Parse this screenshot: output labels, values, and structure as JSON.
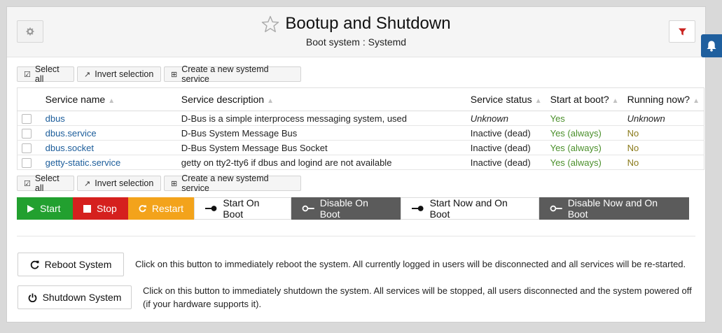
{
  "header": {
    "title": "Bootup and Shutdown",
    "subtitle": "Boot system : Systemd"
  },
  "toolbar": {
    "select_all": "Select all",
    "invert_selection": "Invert selection",
    "create_service": "Create a new systemd service"
  },
  "table": {
    "columns": [
      "Service name",
      "Service description",
      "Service status",
      "Start at boot?",
      "Running now?"
    ],
    "rows": [
      {
        "name": "dbus",
        "description": "D-Bus is a simple interprocess messaging system, used",
        "status": "Unknown",
        "boot": "Yes",
        "running": "Unknown"
      },
      {
        "name": "dbus.service",
        "description": "D-Bus System Message Bus",
        "status": "Inactive (dead)",
        "boot": "Yes (always)",
        "running": "No"
      },
      {
        "name": "dbus.socket",
        "description": "D-Bus System Message Bus Socket",
        "status": "Inactive (dead)",
        "boot": "Yes (always)",
        "running": "No"
      },
      {
        "name": "getty-static.service",
        "description": "getty on tty2-tty6 if dbus and logind are not available",
        "status": "Inactive (dead)",
        "boot": "Yes (always)",
        "running": "No"
      }
    ]
  },
  "actions": {
    "start": "Start",
    "stop": "Stop",
    "restart": "Restart",
    "start_on_boot": "Start On Boot",
    "disable_on_boot": "Disable On Boot",
    "start_now_and_on_boot": "Start Now and On Boot",
    "disable_now_and_on_boot": "Disable Now and On Boot"
  },
  "system": {
    "reboot_label": "Reboot System",
    "reboot_desc": "Click on this button to immediately reboot the system. All currently logged in users will be disconnected and all services will be re-started.",
    "shutdown_label": "Shutdown System",
    "shutdown_desc_line1": "Click on this button to immediately shutdown the system. All services will be stopped, all users disconnected and the system powered off",
    "shutdown_desc_line2": "(if your hardware supports it)."
  },
  "colors": {
    "start": "#22a02f",
    "stop": "#d5201e",
    "restart": "#f3a31b",
    "disable": "#5b5b5b",
    "link": "#1b5c9a",
    "notification_tab": "#1f5f9e"
  },
  "icons": [
    "gear-icon",
    "star-icon",
    "filter-icon",
    "bell-icon",
    "check-square-icon",
    "invert-icon",
    "plus-square-icon",
    "play-icon",
    "stop-icon",
    "refresh-icon",
    "key-on-icon",
    "key-off-icon",
    "reload-icon",
    "power-icon"
  ]
}
